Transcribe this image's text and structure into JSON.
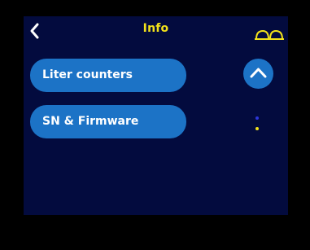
{
  "header": {
    "title": "Info",
    "back_icon": "chevron-left-icon",
    "status_icon": "glasses-icon"
  },
  "menu": {
    "items": [
      {
        "label": "Liter counters"
      },
      {
        "label": "SN & Firmware"
      }
    ]
  },
  "scroll": {
    "up_icon": "chevron-up-icon",
    "page_indicator": {
      "pages": 2,
      "current": 2
    }
  },
  "colors": {
    "screen_bg": "#030b3e",
    "accent_blue": "#1c73c6",
    "title_yellow": "#f2e21a",
    "inactive_dot": "#2d37d9"
  }
}
